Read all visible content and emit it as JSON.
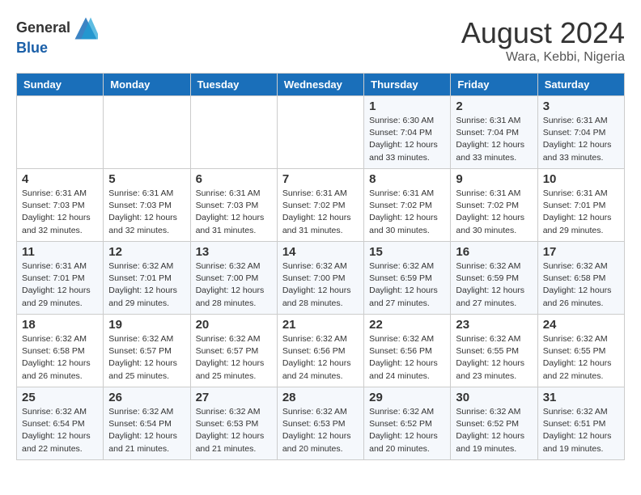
{
  "header": {
    "logo_general": "General",
    "logo_blue": "Blue",
    "month_year": "August 2024",
    "location": "Wara, Kebbi, Nigeria"
  },
  "days_of_week": [
    "Sunday",
    "Monday",
    "Tuesday",
    "Wednesday",
    "Thursday",
    "Friday",
    "Saturday"
  ],
  "weeks": [
    [
      {
        "day": "",
        "info": ""
      },
      {
        "day": "",
        "info": ""
      },
      {
        "day": "",
        "info": ""
      },
      {
        "day": "",
        "info": ""
      },
      {
        "day": "1",
        "info": "Sunrise: 6:30 AM\nSunset: 7:04 PM\nDaylight: 12 hours\nand 33 minutes."
      },
      {
        "day": "2",
        "info": "Sunrise: 6:31 AM\nSunset: 7:04 PM\nDaylight: 12 hours\nand 33 minutes."
      },
      {
        "day": "3",
        "info": "Sunrise: 6:31 AM\nSunset: 7:04 PM\nDaylight: 12 hours\nand 33 minutes."
      }
    ],
    [
      {
        "day": "4",
        "info": "Sunrise: 6:31 AM\nSunset: 7:03 PM\nDaylight: 12 hours\nand 32 minutes."
      },
      {
        "day": "5",
        "info": "Sunrise: 6:31 AM\nSunset: 7:03 PM\nDaylight: 12 hours\nand 32 minutes."
      },
      {
        "day": "6",
        "info": "Sunrise: 6:31 AM\nSunset: 7:03 PM\nDaylight: 12 hours\nand 31 minutes."
      },
      {
        "day": "7",
        "info": "Sunrise: 6:31 AM\nSunset: 7:02 PM\nDaylight: 12 hours\nand 31 minutes."
      },
      {
        "day": "8",
        "info": "Sunrise: 6:31 AM\nSunset: 7:02 PM\nDaylight: 12 hours\nand 30 minutes."
      },
      {
        "day": "9",
        "info": "Sunrise: 6:31 AM\nSunset: 7:02 PM\nDaylight: 12 hours\nand 30 minutes."
      },
      {
        "day": "10",
        "info": "Sunrise: 6:31 AM\nSunset: 7:01 PM\nDaylight: 12 hours\nand 29 minutes."
      }
    ],
    [
      {
        "day": "11",
        "info": "Sunrise: 6:31 AM\nSunset: 7:01 PM\nDaylight: 12 hours\nand 29 minutes."
      },
      {
        "day": "12",
        "info": "Sunrise: 6:32 AM\nSunset: 7:01 PM\nDaylight: 12 hours\nand 29 minutes."
      },
      {
        "day": "13",
        "info": "Sunrise: 6:32 AM\nSunset: 7:00 PM\nDaylight: 12 hours\nand 28 minutes."
      },
      {
        "day": "14",
        "info": "Sunrise: 6:32 AM\nSunset: 7:00 PM\nDaylight: 12 hours\nand 28 minutes."
      },
      {
        "day": "15",
        "info": "Sunrise: 6:32 AM\nSunset: 6:59 PM\nDaylight: 12 hours\nand 27 minutes."
      },
      {
        "day": "16",
        "info": "Sunrise: 6:32 AM\nSunset: 6:59 PM\nDaylight: 12 hours\nand 27 minutes."
      },
      {
        "day": "17",
        "info": "Sunrise: 6:32 AM\nSunset: 6:58 PM\nDaylight: 12 hours\nand 26 minutes."
      }
    ],
    [
      {
        "day": "18",
        "info": "Sunrise: 6:32 AM\nSunset: 6:58 PM\nDaylight: 12 hours\nand 26 minutes."
      },
      {
        "day": "19",
        "info": "Sunrise: 6:32 AM\nSunset: 6:57 PM\nDaylight: 12 hours\nand 25 minutes."
      },
      {
        "day": "20",
        "info": "Sunrise: 6:32 AM\nSunset: 6:57 PM\nDaylight: 12 hours\nand 25 minutes."
      },
      {
        "day": "21",
        "info": "Sunrise: 6:32 AM\nSunset: 6:56 PM\nDaylight: 12 hours\nand 24 minutes."
      },
      {
        "day": "22",
        "info": "Sunrise: 6:32 AM\nSunset: 6:56 PM\nDaylight: 12 hours\nand 24 minutes."
      },
      {
        "day": "23",
        "info": "Sunrise: 6:32 AM\nSunset: 6:55 PM\nDaylight: 12 hours\nand 23 minutes."
      },
      {
        "day": "24",
        "info": "Sunrise: 6:32 AM\nSunset: 6:55 PM\nDaylight: 12 hours\nand 22 minutes."
      }
    ],
    [
      {
        "day": "25",
        "info": "Sunrise: 6:32 AM\nSunset: 6:54 PM\nDaylight: 12 hours\nand 22 minutes."
      },
      {
        "day": "26",
        "info": "Sunrise: 6:32 AM\nSunset: 6:54 PM\nDaylight: 12 hours\nand 21 minutes."
      },
      {
        "day": "27",
        "info": "Sunrise: 6:32 AM\nSunset: 6:53 PM\nDaylight: 12 hours\nand 21 minutes."
      },
      {
        "day": "28",
        "info": "Sunrise: 6:32 AM\nSunset: 6:53 PM\nDaylight: 12 hours\nand 20 minutes."
      },
      {
        "day": "29",
        "info": "Sunrise: 6:32 AM\nSunset: 6:52 PM\nDaylight: 12 hours\nand 20 minutes."
      },
      {
        "day": "30",
        "info": "Sunrise: 6:32 AM\nSunset: 6:52 PM\nDaylight: 12 hours\nand 19 minutes."
      },
      {
        "day": "31",
        "info": "Sunrise: 6:32 AM\nSunset: 6:51 PM\nDaylight: 12 hours\nand 19 minutes."
      }
    ]
  ]
}
